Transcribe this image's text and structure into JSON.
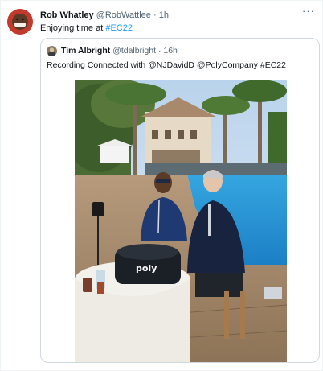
{
  "tweet": {
    "author_name": "Rob Whatley",
    "author_handle": "@RobWattlee",
    "separator": "·",
    "time": "1h",
    "text": "Enjoying time at ",
    "hashtag": "#EC22",
    "more_label": "···"
  },
  "quote": {
    "author_name": "Tim Albright",
    "author_handle": "@tdalbright",
    "separator": "·",
    "time": "16h",
    "text": "Recording Connected with @NJDavidD @PolyCompany #EC22"
  },
  "photo": {
    "bag_brand": "poly"
  },
  "colors": {
    "link": "#1d9bf0",
    "secondary_text": "#536471",
    "border": "#cfd9de"
  }
}
